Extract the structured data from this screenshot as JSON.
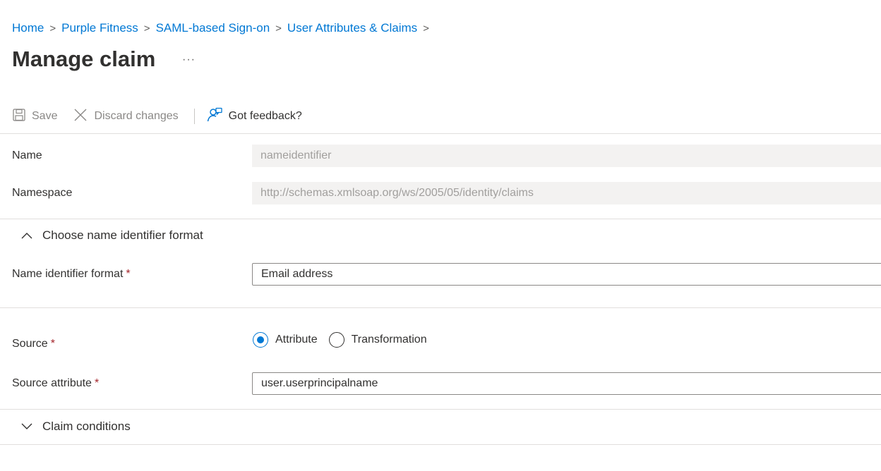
{
  "breadcrumb": {
    "items": [
      "Home",
      "Purple Fitness",
      "SAML-based Sign-on",
      "User Attributes & Claims"
    ],
    "separator": ">"
  },
  "page": {
    "title": "Manage claim",
    "more": "···"
  },
  "toolbar": {
    "save_label": "Save",
    "discard_label": "Discard changes",
    "feedback_label": "Got feedback?"
  },
  "form": {
    "name_label": "Name",
    "name_value": "nameidentifier",
    "namespace_label": "Namespace",
    "namespace_value": "http://schemas.xmlsoap.org/ws/2005/05/identity/claims",
    "format_section_label": "Choose name identifier format",
    "format_label": "Name identifier format",
    "format_value": "Email address",
    "source_label": "Source",
    "source_options": [
      "Attribute",
      "Transformation"
    ],
    "source_selected": "Attribute",
    "source_attribute_label": "Source attribute",
    "source_attribute_value": "user.userprincipalname",
    "conditions_section_label": "Claim conditions",
    "required_marker": "*"
  },
  "colors": {
    "accent": "#0078d4",
    "required": "#a4262c",
    "disabled_text": "#8a8886"
  },
  "icons": {
    "save": "save-icon",
    "discard": "close-icon",
    "feedback": "feedback-icon",
    "expand_up": "chevron-up-icon",
    "expand_down": "chevron-down-icon"
  }
}
